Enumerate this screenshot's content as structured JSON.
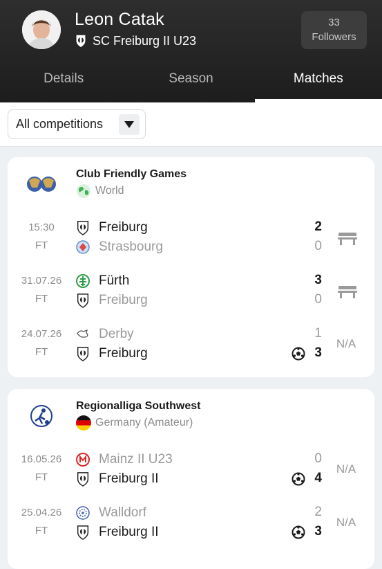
{
  "header": {
    "player_name": "Leon Catak",
    "club": "SC Freiburg II U23",
    "followers_count": "33",
    "followers_label": "Followers"
  },
  "tabs": [
    {
      "label": "Details",
      "active": false
    },
    {
      "label": "Season",
      "active": false
    },
    {
      "label": "Matches",
      "active": true
    }
  ],
  "filter": {
    "selected": "All competitions"
  },
  "competitions": [
    {
      "name": "Club Friendly Games",
      "country": "World",
      "matches": [
        {
          "date": "15:30",
          "status": "FT",
          "home": "Freiburg",
          "away": "Strasbourg",
          "home_score": "2",
          "away_score": "0",
          "rating": ""
        },
        {
          "date": "31.07.26",
          "status": "FT",
          "home": "Fürth",
          "away": "Freiburg",
          "home_score": "3",
          "away_score": "0",
          "rating": ""
        },
        {
          "date": "24.07.26",
          "status": "FT",
          "home": "Derby",
          "away": "Freiburg",
          "home_score": "1",
          "away_score": "3",
          "rating": "N/A"
        }
      ]
    },
    {
      "name": "Regionalliga Southwest",
      "country": "Germany (Amateur)",
      "matches": [
        {
          "date": "16.05.26",
          "status": "FT",
          "home": "Mainz II U23",
          "away": "Freiburg II",
          "home_score": "0",
          "away_score": "4",
          "rating": "N/A"
        },
        {
          "date": "25.04.26",
          "status": "FT",
          "home": "Walldorf",
          "away": "Freiburg II",
          "home_score": "2",
          "away_score": "3",
          "rating": "N/A"
        }
      ]
    }
  ],
  "colors": {
    "header_bg": "#1d1d1d",
    "card_bg": "#ffffff",
    "page_bg": "#eef1f4",
    "muted": "#9a9a9a"
  },
  "icons": [
    "freiburg-crest-icon",
    "strasbourg-crest-icon",
    "fuerth-crest-icon",
    "derby-crest-icon",
    "mainz-crest-icon",
    "walldorf-crest-icon",
    "globe-icon",
    "germany-flag-icon",
    "bench-icon",
    "football-icon",
    "chevron-down-icon"
  ]
}
